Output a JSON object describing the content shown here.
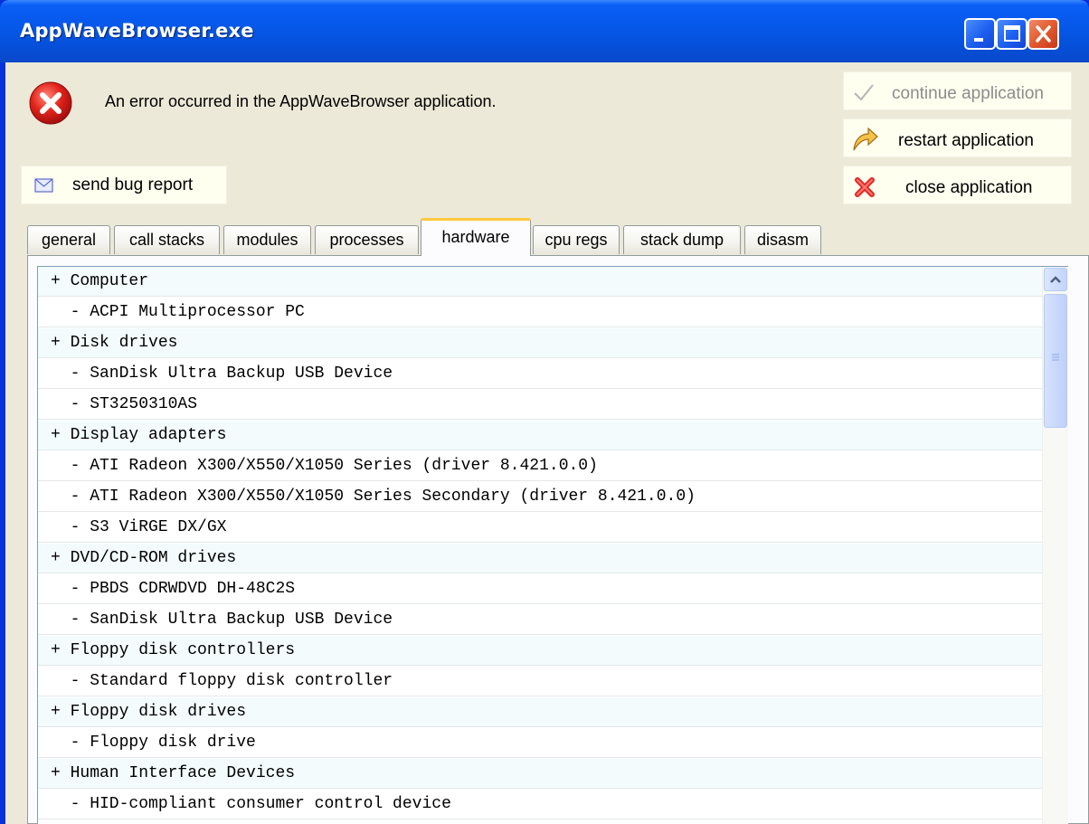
{
  "window": {
    "title": "AppWaveBrowser.exe",
    "buttons": [
      "minimize-icon",
      "maximize-icon",
      "close-icon"
    ]
  },
  "header": {
    "error_icon": "error-icon",
    "message": "An error occurred in the AppWaveBrowser application."
  },
  "actions": {
    "continue_label": "continue application",
    "restart_label": "restart application",
    "close_label": "close application",
    "bug_report_label": "send bug report"
  },
  "tabs": [
    {
      "label": "general"
    },
    {
      "label": "call stacks"
    },
    {
      "label": "modules"
    },
    {
      "label": "processes"
    },
    {
      "label": "hardware"
    },
    {
      "label": "cpu regs"
    },
    {
      "label": "stack dump"
    },
    {
      "label": "disasm"
    }
  ],
  "active_tab": "hardware",
  "hardware_list": [
    "+ Computer",
    "  - ACPI Multiprocessor PC",
    "+ Disk drives",
    "  - SanDisk Ultra Backup USB Device",
    "  - ST3250310AS",
    "+ Display adapters",
    "  - ATI Radeon X300/X550/X1050 Series (driver 8.421.0.0)",
    "  - ATI Radeon X300/X550/X1050 Series Secondary (driver 8.421.0.0)",
    "  - S3 ViRGE DX/GX",
    "+ DVD/CD-ROM drives",
    "  - PBDS CDRWDVD DH-48C2S",
    "  - SanDisk Ultra Backup USB Device",
    "+ Floppy disk controllers",
    "  - Standard floppy disk controller",
    "+ Floppy disk drives",
    "  - Floppy disk drive",
    "+ Human Interface Devices",
    "  - HID-compliant consumer control device"
  ],
  "colors": {
    "titlebar": "#0a5ff5",
    "client": "#ece9d8",
    "active_tab_accent": "#ffc83c"
  }
}
